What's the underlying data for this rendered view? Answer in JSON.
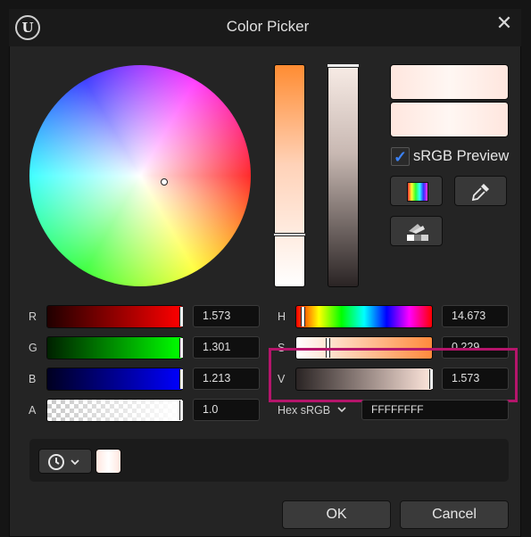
{
  "window": {
    "title": "Color Picker",
    "logo_text": "U"
  },
  "srgb_preview": {
    "label": "sRGB Preview",
    "checked": true
  },
  "channels": {
    "r": {
      "label": "R",
      "value": "1.573"
    },
    "g": {
      "label": "G",
      "value": "1.301"
    },
    "b": {
      "label": "B",
      "value": "1.213"
    },
    "a": {
      "label": "A",
      "value": "1.0"
    },
    "h": {
      "label": "H",
      "value": "14.673"
    },
    "s": {
      "label": "S",
      "value": "0.229"
    },
    "v": {
      "label": "V",
      "value": "1.573"
    }
  },
  "hex": {
    "label": "Hex sRGB",
    "value": "FFFFFFFF"
  },
  "buttons": {
    "ok": "OK",
    "cancel": "Cancel"
  },
  "colors": {
    "highlight": "#b5156b",
    "checkbox_accent": "#3b82f6"
  },
  "icons": [
    "close-icon",
    "unreal-logo-icon",
    "color-spectrum-icon",
    "eyedropper-icon",
    "theme-icon",
    "clock-icon",
    "chevron-down-icon"
  ]
}
